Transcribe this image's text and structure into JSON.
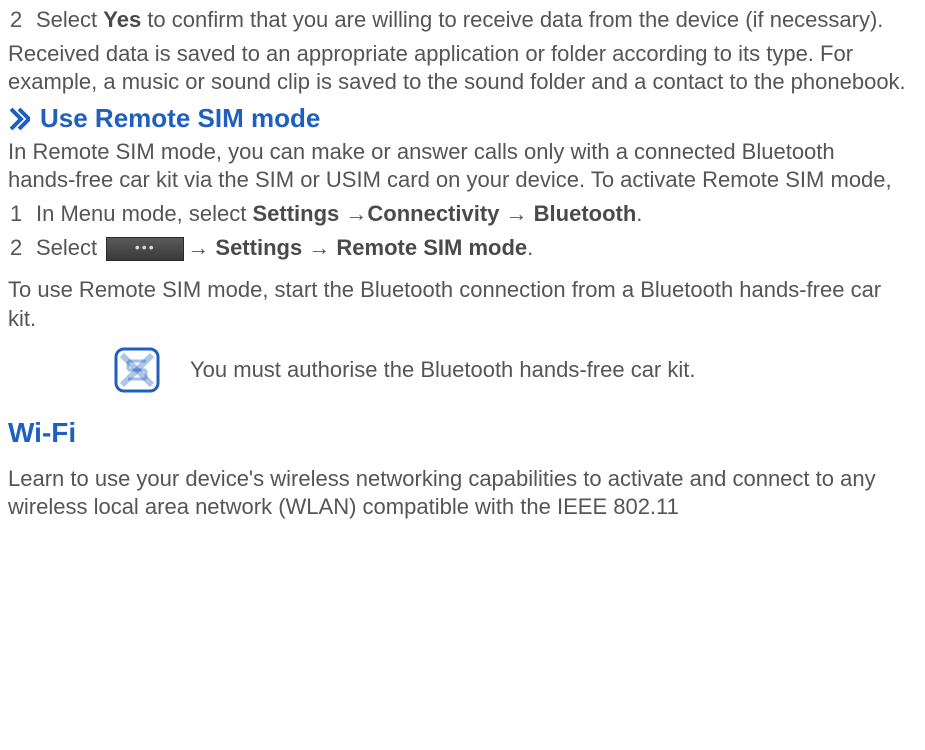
{
  "step2": {
    "num": "2",
    "pre": "Select ",
    "bold": "Yes",
    "post": " to confirm that you are willing to receive data from the device (if necessary)."
  },
  "received_para": "Received data is saved to an appropriate application or folder according to its type. For example, a music or sound clip is saved to the sound folder and a contact to the phonebook.",
  "sim_heading": "Use Remote SIM mode",
  "sim_intro": "In Remote SIM mode, you can make or answer calls only with a connected Bluetooth hands-free car kit via the SIM or USIM card on your device. To activate Remote SIM mode,",
  "sim_step1": {
    "num": "1",
    "pre": "In Menu mode, select ",
    "b1": "Settings",
    "arr1": " →",
    "b2": "Connectivity",
    "arr2": " → ",
    "b3": "Bluetooth",
    "post": "."
  },
  "sim_step2": {
    "num": "2",
    "pre": "Select ",
    "arr1": "→ ",
    "b1": "Settings",
    "arr2": " → ",
    "b2": "Remote SIM mode",
    "post": "."
  },
  "sim_use_para": "To use Remote SIM mode, start the Bluetooth connection from a Bluetooth hands-free car kit.",
  "note_text": "You must authorise the Bluetooth hands-free car kit.",
  "wifi_heading": "Wi-Fi",
  "wifi_para": "Learn to use your device's wireless networking capabilities to activate and connect to any wireless local area network (WLAN) compatible with the IEEE 802.11"
}
